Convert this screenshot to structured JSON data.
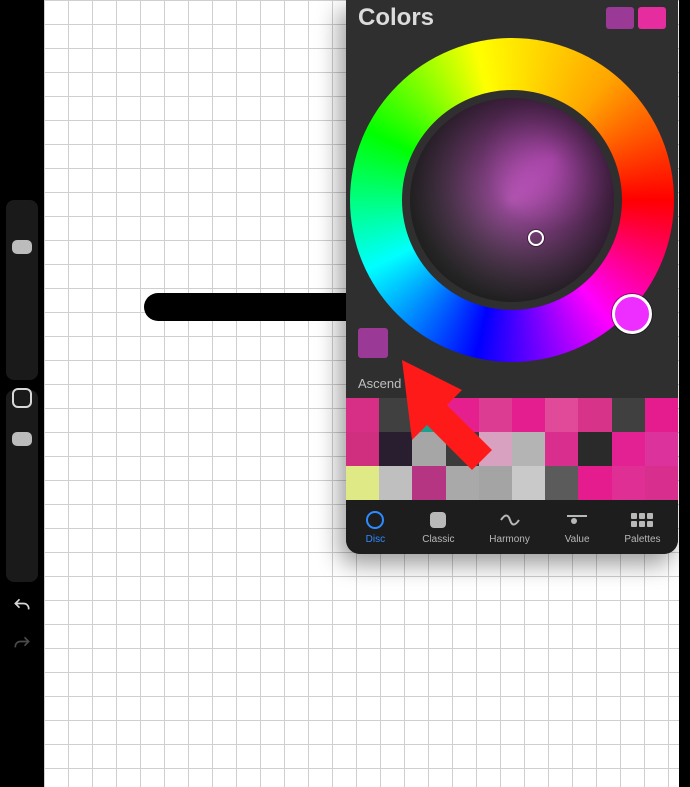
{
  "panel": {
    "title": "Colors",
    "current_color": "#9a3a96",
    "compare_color": "#e52da0",
    "history_swatch": "#9a3a96",
    "palette_name": "Ascend",
    "palette_rows": [
      [
        "#d72f86",
        "#404040",
        "#1fa08c",
        "#e61f8e",
        "#dc3c91",
        "#e51e8f",
        "#e04a98",
        "#d73388",
        "#404040",
        "#e41c8d"
      ],
      [
        "#cf2f7e",
        "#281e30",
        "#a6a6a6",
        "#3b3b3b",
        "#d8a1c0",
        "#b4b4b4",
        "#da2e8f",
        "#2a2a2a",
        "#e32193",
        "#db339b"
      ],
      [
        "#dfe986",
        "#bfbfbf",
        "#b53582",
        "#a9a9a9",
        "#a4a4a4",
        "#c9c9c9",
        "#5b5b5b",
        "#e41c8d",
        "#df2f94",
        "#d82e8d"
      ]
    ]
  },
  "tabs": {
    "disc": "Disc",
    "classic": "Classic",
    "harmony": "Harmony",
    "value": "Value",
    "palettes": "Palettes",
    "active": "disc"
  },
  "sidebar": {
    "undo_label": "Undo",
    "redo_label": "Redo"
  }
}
